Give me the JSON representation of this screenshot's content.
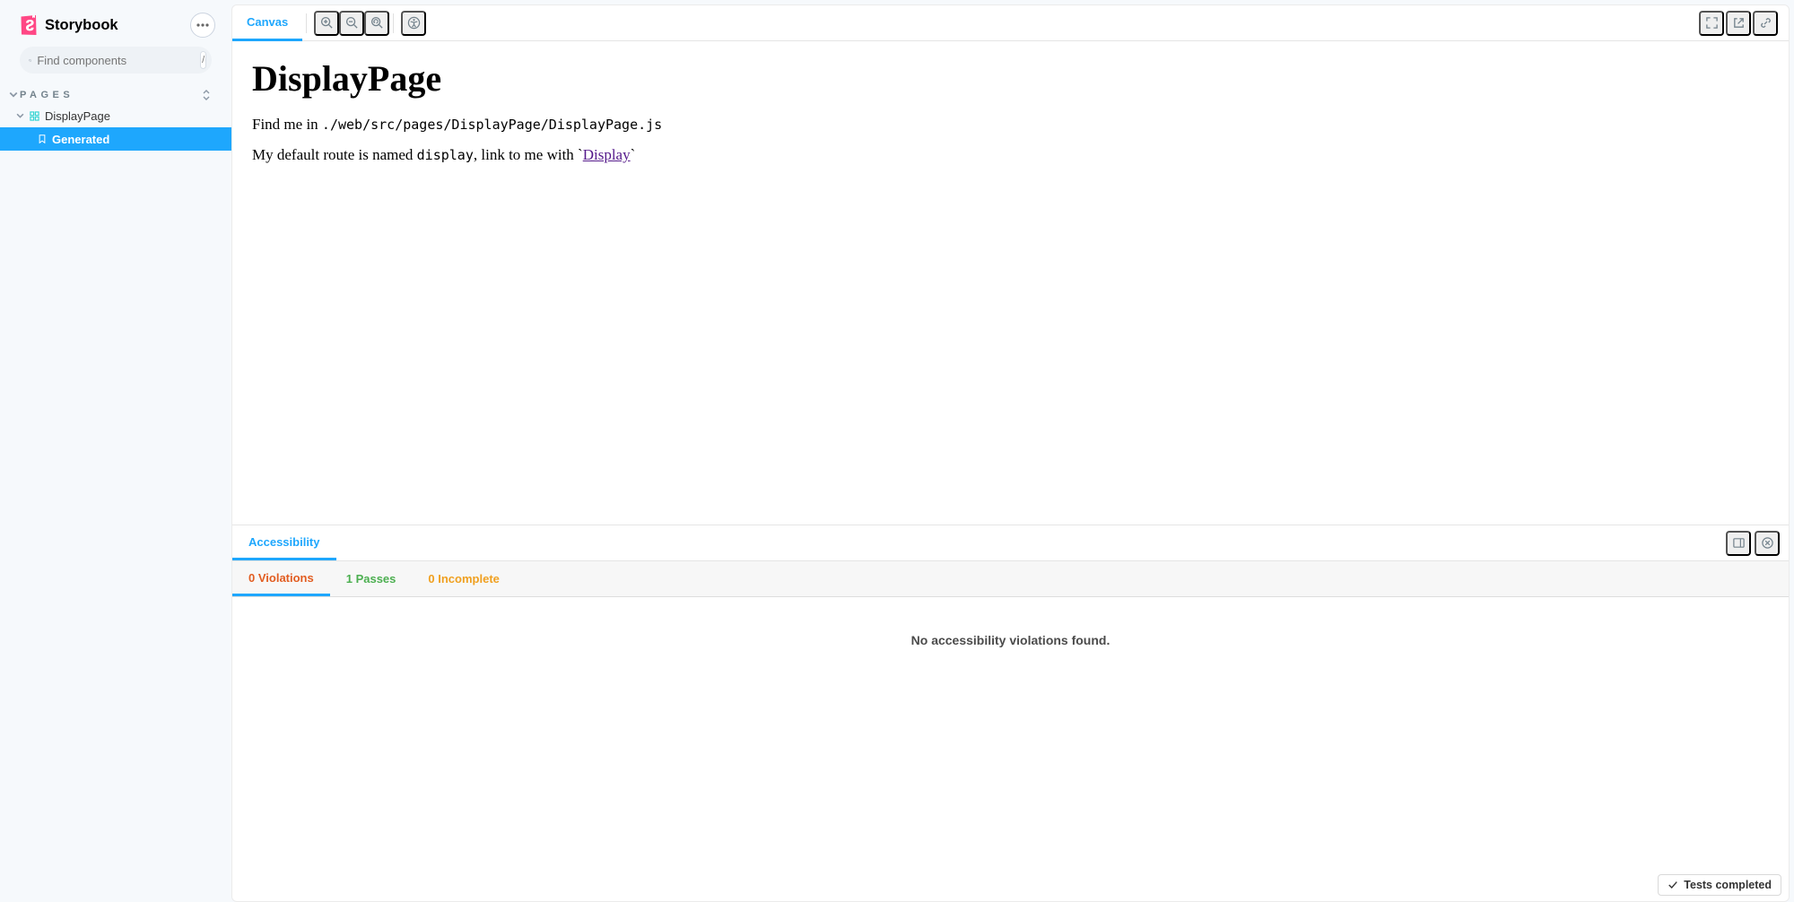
{
  "brand": {
    "name": "Storybook"
  },
  "search": {
    "placeholder": "Find components",
    "shortcut": "/"
  },
  "sidebar": {
    "section": "PAGES",
    "component": "DisplayPage",
    "story": "Generated"
  },
  "toolbar": {
    "tab": "Canvas"
  },
  "canvas": {
    "title": "DisplayPage",
    "line1_pre": "Find me in ",
    "line1_code": "./web/src/pages/DisplayPage/DisplayPage.js",
    "line2_pre": "My default route is named ",
    "line2_code": "display",
    "line2_mid": ", link to me with `",
    "link": "Display",
    "line2_post": "`"
  },
  "addons": {
    "tab": "Accessibility",
    "violations": "0 Violations",
    "passes": "1 Passes",
    "incomplete": "0 Incomplete",
    "empty": "No accessibility violations found."
  },
  "status": {
    "text": "Tests completed"
  }
}
